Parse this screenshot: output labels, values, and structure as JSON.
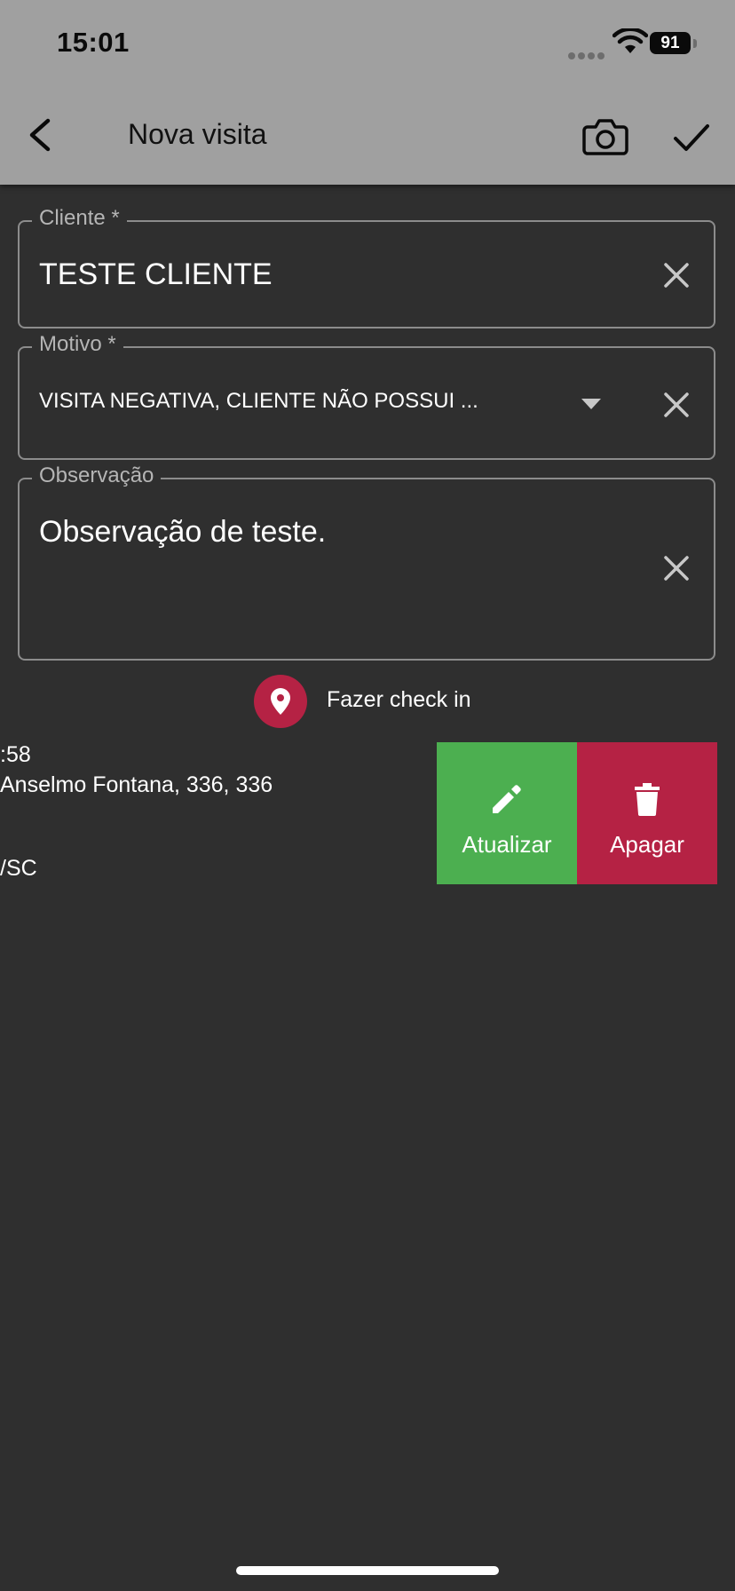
{
  "status_bar": {
    "time": "15:01",
    "battery": "91"
  },
  "appbar": {
    "title": "Nova visita"
  },
  "form": {
    "cliente": {
      "label": "Cliente *",
      "value": "TESTE CLIENTE"
    },
    "motivo": {
      "label": "Motivo *",
      "value": "VISITA NEGATIVA, CLIENTE NÃO POSSUI ..."
    },
    "observacao": {
      "label": "Observação",
      "value": "Observação de teste."
    }
  },
  "checkin": {
    "label": "Fazer check in"
  },
  "visit_item": {
    "time_fragment": ":58",
    "address_fragment": "Anselmo Fontana, 336, 336",
    "state_fragment": "/SC"
  },
  "actions": {
    "update_label": "Atualizar",
    "delete_label": "Apagar"
  },
  "colors": {
    "appbar": "#a0a0a0",
    "background": "#2f2f2f",
    "update": "#4caf50",
    "delete": "#b52244",
    "checkin_pin": "#b52244"
  }
}
